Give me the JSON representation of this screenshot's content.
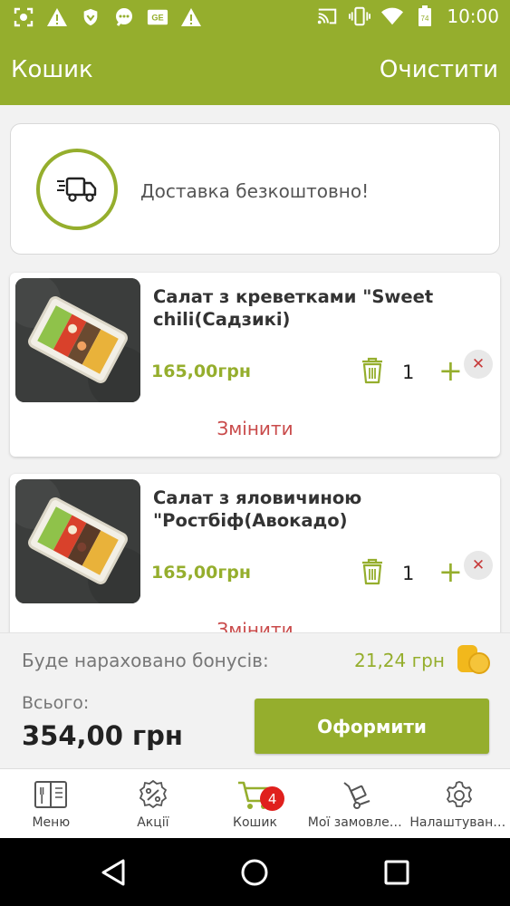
{
  "status_bar": {
    "time": "10:00",
    "battery_level": "74",
    "left_icons": [
      "screenshot-icon",
      "warning-icon",
      "shield-icon",
      "chat-icon",
      "news-icon",
      "warning-icon"
    ],
    "right_icons": [
      "cast-icon",
      "vibrate-icon",
      "wifi-icon",
      "battery-icon"
    ]
  },
  "appbar": {
    "title": "Кошик",
    "clear_label": "Очистити"
  },
  "delivery": {
    "text": "Доставка безкоштовно!"
  },
  "cart": {
    "items": [
      {
        "name": "Салат з креветками \"Sweet chili(Садзикі)",
        "price": "165,00грн",
        "quantity": "1",
        "remove_symbol": "✕",
        "plus_symbol": "+",
        "change_label": "Змінити"
      },
      {
        "name": "Салат з яловичиною \"Ростбіф(Авокадо)",
        "price": "165,00грн",
        "quantity": "1",
        "remove_symbol": "✕",
        "plus_symbol": "+",
        "change_label": "Змінити"
      }
    ]
  },
  "summary": {
    "bonus_label": "Буде нараховано бонусів:",
    "bonus_value": "21,24 грн",
    "total_label": "Всього:",
    "total_value": "354,00 грн",
    "checkout_label": "Оформити"
  },
  "bottom_nav": {
    "items": [
      {
        "label": "Меню",
        "icon": "menu-book-icon"
      },
      {
        "label": "Акції",
        "icon": "discount-icon"
      },
      {
        "label": "Кошик",
        "icon": "cart-icon",
        "badge": "4"
      },
      {
        "label": "Мої замовлення",
        "icon": "orders-icon"
      },
      {
        "label": "Налаштування",
        "icon": "settings-icon"
      }
    ]
  },
  "colors": {
    "accent": "#95ae2d",
    "danger": "#c94a4a",
    "badge": "#e0201d"
  }
}
